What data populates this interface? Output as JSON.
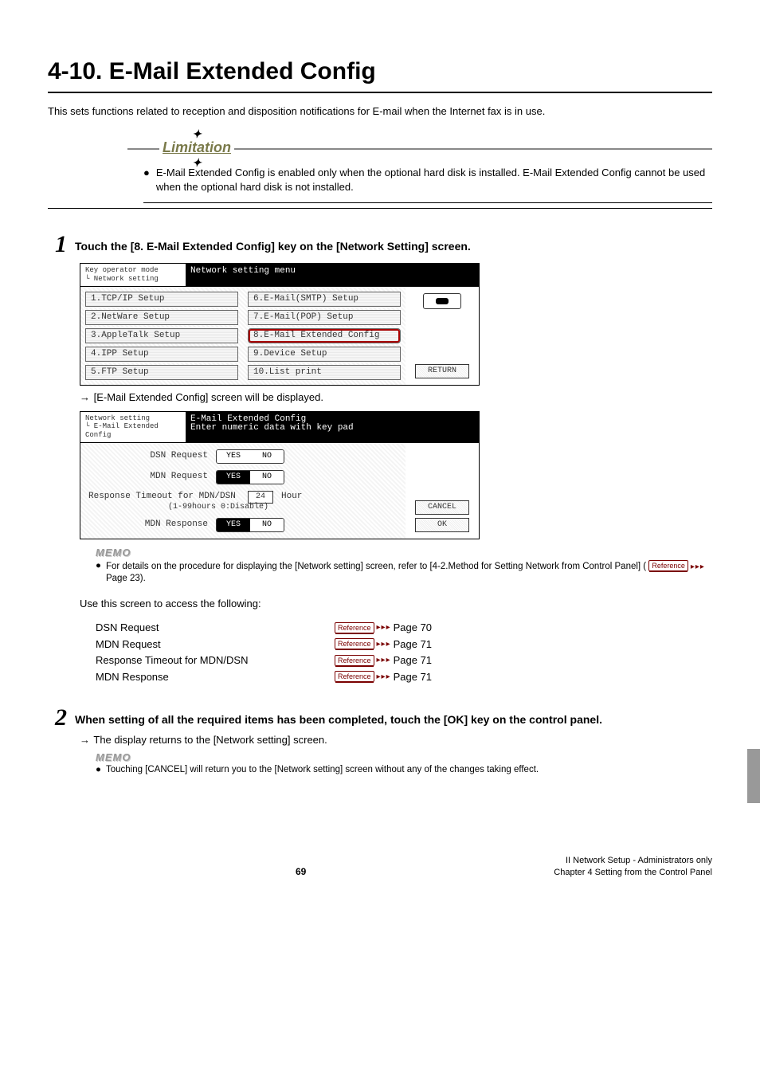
{
  "title": "4-10. E-Mail Extended Config",
  "intro": "This sets functions related to reception and disposition notifications for E-mail when the Internet fax is in use.",
  "limitation": {
    "label": "Limitation",
    "body": "E-Mail Extended Config is enabled only when the optional hard disk is installed. E-Mail Extended Config cannot be used when the optional hard disk is not installed."
  },
  "step1": {
    "num": "1",
    "heading": "Touch the [8. E-Mail Extended Config] key on the [Network Setting] screen.",
    "panel": {
      "hdr_left_l1": "Key operator mode",
      "hdr_left_l2": "└ Network setting",
      "hdr_right": "Network setting menu",
      "col1": [
        "1.TCP/IP Setup",
        "2.NetWare Setup",
        "3.AppleTalk Setup",
        "4.IPP Setup",
        "5.FTP Setup"
      ],
      "col2": [
        "6.E-Mail(SMTP) Setup",
        "7.E-Mail(POP) Setup",
        "8.E-Mail Extended Config",
        "9.Device Setup",
        "10.List print"
      ],
      "return": "RETURN"
    },
    "result": "[E-Mail Extended Config] screen will be displayed.",
    "panel2": {
      "hdr_left_l1": "Network setting",
      "hdr_left_l2": "└ E-Mail Extended Config",
      "hdr_right_l1": "E-Mail Extended Config",
      "hdr_right_l2": "Enter numeric data with key pad",
      "rows": {
        "dsn_label": "DSN Request",
        "mdn_label": "MDN Request",
        "timeout_label": "Response Timeout for MDN/DSN",
        "timeout_val": "24",
        "timeout_unit": "Hour",
        "timeout_hint": "(1-99hours    0:Disable)",
        "resp_label": "MDN Response",
        "yes": "YES",
        "no": "NO"
      },
      "cancel": "CANCEL",
      "ok": "OK"
    },
    "memo_label": "MEMO",
    "memo_body": "For details on the procedure for displaying the [Network setting] screen, refer to [4-2.Method for Setting Network from Control Panel] ( ",
    "memo_page": " Page 23).",
    "access_line": "Use this screen to access the following:",
    "refs": [
      {
        "name": "DSN Request",
        "page": "Page 70"
      },
      {
        "name": "MDN Request",
        "page": "Page 71"
      },
      {
        "name": "Response Timeout for MDN/DSN",
        "page": "Page 71"
      },
      {
        "name": "MDN Response",
        "page": "Page 71"
      }
    ],
    "ref_badge": "Reference"
  },
  "step2": {
    "num": "2",
    "heading": "When setting of all the required items has been completed, touch the [OK] key on the control panel.",
    "result": "The display returns to the [Network setting] screen.",
    "memo_label": "MEMO",
    "memo_body": "Touching [CANCEL] will return you to the [Network setting] screen without any of the changes taking effect."
  },
  "footer": {
    "page": "69",
    "r1": "II Network Setup - Administrators only",
    "r2": "Chapter 4 Setting from the Control Panel"
  }
}
